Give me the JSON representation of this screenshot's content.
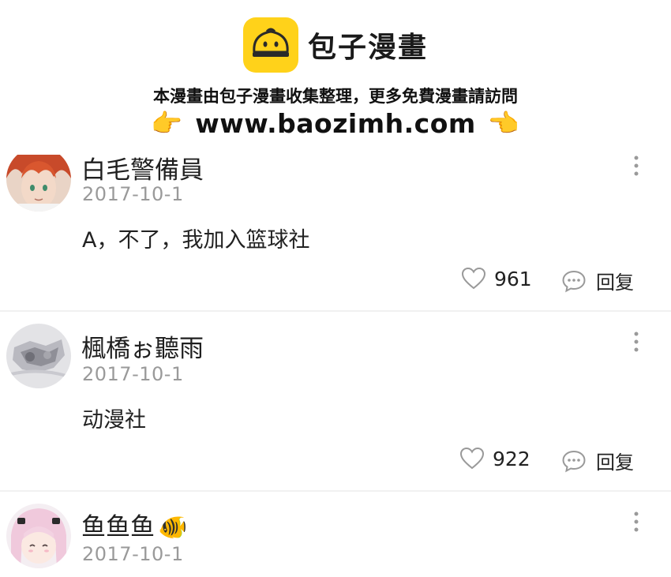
{
  "watermark": {
    "brand": "包子漫畫",
    "notice": "本漫畫由包子漫畫收集整理，更多免費漫畫請訪問",
    "hand_left": "👉",
    "url": "www.baozimh.com",
    "hand_right": "👉"
  },
  "comments": [
    {
      "username": "白毛警備員",
      "date": "2017-10-1",
      "text": "A，不了，我加入篮球社",
      "likes": "961",
      "reply_label": "回复"
    },
    {
      "username": "楓橋ぉ聽雨",
      "date": "2017-10-1",
      "text": "动漫社",
      "likes": "922",
      "reply_label": "回复"
    },
    {
      "username": "鱼鱼鱼",
      "username_emoji": "🐠",
      "date": "2017-10-1"
    }
  ],
  "icons": {
    "like": "heart-icon",
    "reply": "chat-bubble-icon",
    "more": "more-vertical-icon"
  },
  "colors": {
    "logo": "#ffd21a",
    "date": "#9a9a9a",
    "divider": "#f1f1f1"
  }
}
